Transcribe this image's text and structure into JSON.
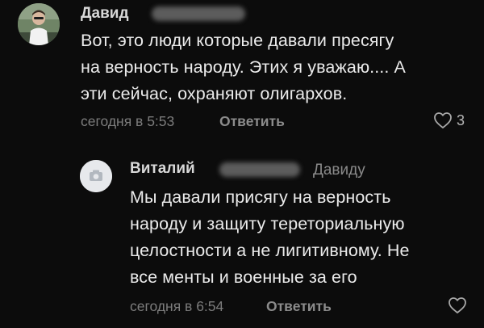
{
  "comment": {
    "author": "Давид",
    "text_lines": [
      "Вот, это люди которые давали пресягу",
      "на верность народу. Этих я уважаю.... А",
      "эти сейчас, охраняют олигархов."
    ],
    "time": "сегодня в 5:53",
    "reply_label": "Ответить",
    "like_count": "3",
    "like_icon": "heart-outline-icon"
  },
  "reply": {
    "author": "Виталий",
    "reply_to": "Давиду",
    "avatar_icon": "camera-placeholder-icon",
    "text_lines": [
      "Мы давали присягу на верность",
      "народу и защиту тереториальную",
      "целостности а не лигитивному. Не",
      "все менты и военные за его"
    ],
    "time": "сегодня в 6:54",
    "reply_label": "Ответить",
    "like_icon": "heart-outline-icon"
  }
}
